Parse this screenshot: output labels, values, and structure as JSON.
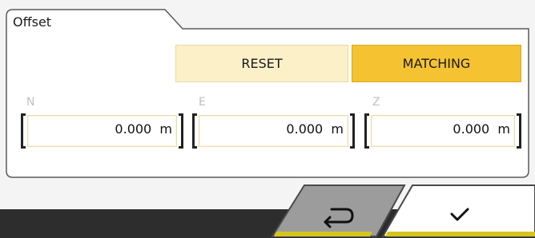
{
  "panel": {
    "title": "Offset"
  },
  "buttons": {
    "reset_label": "RESET",
    "matching_label": "MATCHING"
  },
  "fields": [
    {
      "label": "N",
      "value": "0.000",
      "unit": "m"
    },
    {
      "label": "E",
      "value": "0.000",
      "unit": "m"
    },
    {
      "label": "Z",
      "value": "0.000",
      "unit": "m"
    }
  ],
  "footer": {
    "back_icon": "return-arrow-icon",
    "confirm_icon": "checkmark-icon"
  },
  "colors": {
    "accent": "#f5c232",
    "accent_light": "#fbf0c8",
    "bar_dark": "#2d2d2d",
    "yellow_stripe": "#d8c21c"
  }
}
